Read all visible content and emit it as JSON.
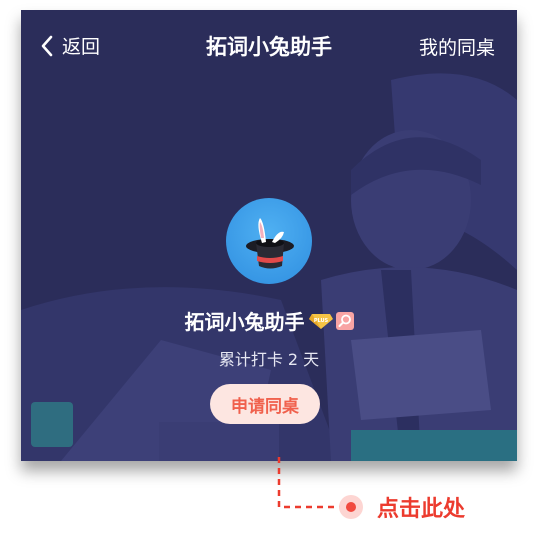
{
  "nav": {
    "back_label": "返回",
    "title": "拓词小兔助手",
    "right_label": "我的同桌"
  },
  "profile": {
    "name": "拓词小兔助手",
    "badges": [
      "plus-diamond-badge",
      "search-badge"
    ],
    "badge_text": "PLUS",
    "days_text": "累计打卡 2 天"
  },
  "apply_button": {
    "label": "申请同桌"
  },
  "hint": {
    "text": "点击此处"
  },
  "colors": {
    "background": "#2b2d5a",
    "button_bg": "#fde6e1",
    "button_text": "#f0614d",
    "hint_red": "#ec3b2e"
  }
}
